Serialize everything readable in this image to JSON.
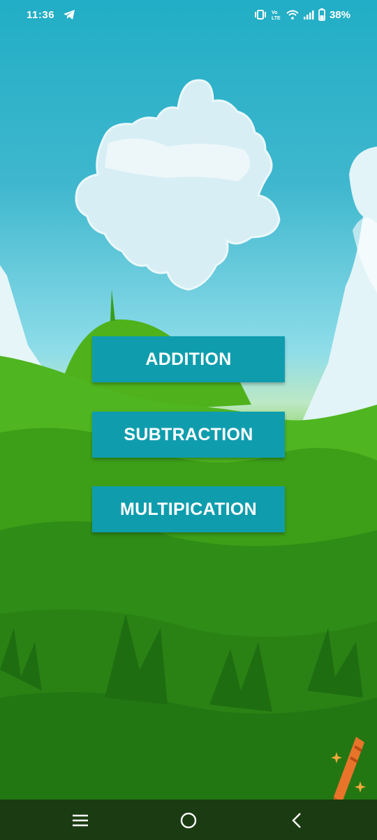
{
  "status_bar": {
    "time": "11:36",
    "battery_percent": "38%",
    "icons": [
      "telegram-icon",
      "vibrate-icon",
      "volte-icon",
      "wifi-icon",
      "signal-icon",
      "battery-icon"
    ]
  },
  "menu": {
    "addition_label": "ADDITION",
    "subtraction_label": "SUBTRACTION",
    "multiplication_label": "MULTIPICATION"
  },
  "navigation": {
    "icons": [
      "menu-icon",
      "home-icon",
      "back-icon"
    ]
  },
  "colors": {
    "button_bg": "#0f9dae",
    "button_text": "#ffffff",
    "sky": "#21aec6",
    "grass": "#3a9d19",
    "nav_bar": "#1b3b12"
  }
}
